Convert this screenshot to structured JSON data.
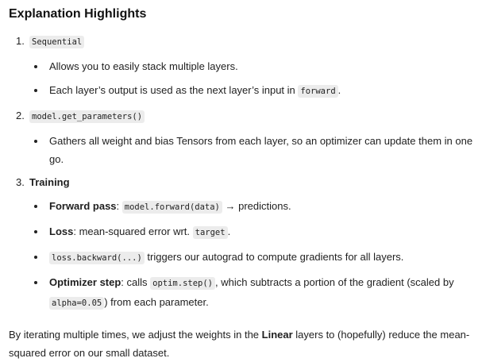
{
  "heading": "Explanation Highlights",
  "items": [
    {
      "num": "1.",
      "title_code": "Sequential",
      "bullets": [
        {
          "text": "Allows you to easily stack multiple layers."
        },
        {
          "pre": "Each layer’s output is used as the next layer’s input in ",
          "code": "forward",
          "post": "."
        }
      ]
    },
    {
      "num": "2.",
      "title_code": "model.get_parameters()",
      "bullets": [
        {
          "text": "Gathers all weight and bias Tensors from each layer, so an optimizer can update them in one go."
        }
      ]
    },
    {
      "num": "3.",
      "title_bold": "Training",
      "bullets": [
        {
          "bold": "Forward pass",
          "pre": ": ",
          "code": "model.forward(data)",
          "post": " → predictions."
        },
        {
          "bold": "Loss",
          "pre": ": mean-squared error wrt. ",
          "code": "target",
          "post": "."
        },
        {
          "code": "loss.backward(...)",
          "post": " triggers our autograd to compute gradients for all layers."
        },
        {
          "bold": "Optimizer step",
          "pre": ": calls ",
          "code": "optim.step()",
          "mid": ", which subtracts a portion of the gradient (scaled by ",
          "code2": "alpha=0.05",
          "post": ") from each parameter."
        }
      ]
    }
  ],
  "closing": {
    "pre": "By iterating multiple times, we adjust the weights in the ",
    "bold": "Linear",
    "post": " layers to (hopefully) reduce the mean-squared error on our small dataset."
  }
}
